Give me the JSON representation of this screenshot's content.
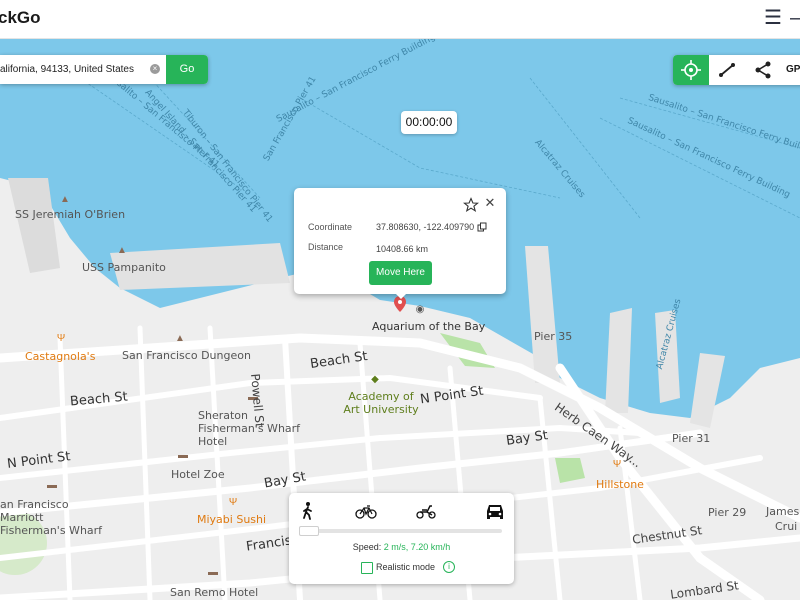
{
  "app": {
    "title": "ckGo",
    "menu_icon": "hamburger-icon",
    "minimize_icon": "minimize-icon"
  },
  "search": {
    "value": "alifornia, 94133, United States",
    "go_label": "Go"
  },
  "toolbar": {
    "teleport_icon": "crosshair-icon",
    "two_spot_icon": "route-line-icon",
    "multi_spot_icon": "share-nodes-icon",
    "gpx_label": "GP"
  },
  "timer": "00:00:00",
  "popup": {
    "coordinate_label": "Coordinate",
    "coordinate_value": "37.808630, -122.409790",
    "distance_label": "Distance",
    "distance_value": "10408.66 km",
    "move_label": "Move Here"
  },
  "speed_panel": {
    "modes": [
      "walk-icon",
      "bike-icon",
      "scooter-icon",
      "car-icon"
    ],
    "speed_label": "Speed:",
    "speed_value": "2 m/s, 7.20 km/h",
    "slider_fraction": 0.03,
    "realistic_label": "Realistic mode"
  },
  "map_labels": {
    "ss_jeremiah": "SS Jeremiah O'Brien",
    "uss_pampanito": "USS Pampanito",
    "aquarium": "Aquarium of the Bay",
    "pier35": "Pier 35",
    "pier31": "Pier 31",
    "pier29": "Pier 29",
    "castagnola": "Castagnola's",
    "sf_dungeon": "San Francisco Dungeon",
    "beach_st_1": "Beach St",
    "beach_st_2": "Beach St",
    "powell_st": "Powell St",
    "academy": "Academy of Art University",
    "n_point_st_1": "N Point St",
    "n_point_st_2": "N Point St",
    "sheraton": "Sheraton Fisherman's Wharf Hotel",
    "bay_st_1": "Bay St",
    "bay_st_2": "Bay St",
    "hotel_zoe": "Hotel Zoe",
    "marriott": "an Francisco Marriott Fisherman's Wharf",
    "miyabi": "Miyabi Sushi",
    "francisco_st": "Francisc",
    "san_remo": "San Remo Hotel",
    "hillstone": "Hillstone",
    "chestnut_st": "Chestnut St",
    "lombard_st": "Lombard St",
    "herb_caen": "Herb Caen Way...",
    "james": "James",
    "cruise_fragment": "Crui",
    "sausalito_1": "Sausalito – San Francisco Ferry Building",
    "sausalito_2": "Sausalito – San Francisco Pier 41",
    "angel_island": "Angel Island – San Francisco Pier 41",
    "tiburon": "Tiburon – San Francisco Pier 41",
    "sf_pier41": "San Francisco Pier 41",
    "alcatraz_cruises": "Alcatraz Cruises",
    "alcatraz_cruises_2": "Alcatraz Cruises",
    "sausalito_ferry": "Sausalito – San Francisco Ferry Building",
    "sausalito_ferry_2": "Sausalito – San Francisco Ferry Building"
  },
  "colors": {
    "accent": "#27b459",
    "water": "#7dc8ea",
    "land": "#eeeeee",
    "road": "#ffffff"
  }
}
